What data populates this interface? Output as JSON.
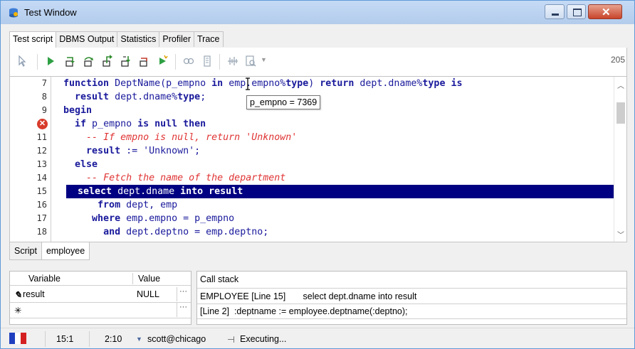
{
  "window": {
    "title": "Test Window"
  },
  "tabs": [
    "Test script",
    "DBMS Output",
    "Statistics",
    "Profiler",
    "Trace"
  ],
  "toolbar": {
    "right_value": "205"
  },
  "editor": {
    "line_numbers": [
      "7",
      "8",
      "9",
      "",
      "11",
      "12",
      "13",
      "14",
      "15",
      "16",
      "17",
      "18"
    ],
    "error_line_icon": "error-x-icon",
    "lines": [
      {
        "indent": "  ",
        "parts": [
          {
            "t": "function",
            "k": 1
          },
          {
            "t": " DeptName(p_empno "
          },
          {
            "t": "in",
            "k": 1
          },
          {
            "t": " emp.empno%"
          },
          {
            "t": "type",
            "k": 1
          },
          {
            "t": ") "
          },
          {
            "t": "return",
            "k": 1
          },
          {
            "t": " dept.dname%"
          },
          {
            "t": "type",
            "k": 1
          },
          {
            "t": " "
          },
          {
            "t": "is",
            "k": 1
          }
        ]
      },
      {
        "indent": "    ",
        "parts": [
          {
            "t": "result",
            "k": 1
          },
          {
            "t": " dept.dname%"
          },
          {
            "t": "type",
            "k": 1
          },
          {
            "t": ";"
          }
        ]
      },
      {
        "indent": "  ",
        "parts": [
          {
            "t": "begin",
            "k": 1
          }
        ]
      },
      {
        "indent": "    ",
        "parts": [
          {
            "t": "if",
            "k": 1
          },
          {
            "t": " p_empno "
          },
          {
            "t": "is null then",
            "k": 1
          }
        ]
      },
      {
        "indent": "      ",
        "parts": [
          {
            "t": "-- If empno is null, return 'Unknown'",
            "c": 1
          }
        ]
      },
      {
        "indent": "      ",
        "parts": [
          {
            "t": "result",
            "k": 1
          },
          {
            "t": " := 'Unknown';"
          }
        ]
      },
      {
        "indent": "    ",
        "parts": [
          {
            "t": "else",
            "k": 1
          }
        ]
      },
      {
        "indent": "      ",
        "parts": [
          {
            "t": "-- Fetch the name of the department",
            "c": 1
          }
        ]
      },
      {
        "indent": "    ",
        "parts": [
          {
            "t": "select",
            "k": 1
          },
          {
            "t": " dept.dname "
          },
          {
            "t": "into result",
            "k": 1
          }
        ]
      },
      {
        "indent": "        ",
        "parts": [
          {
            "t": "from",
            "k": 1
          },
          {
            "t": " dept, emp"
          }
        ]
      },
      {
        "indent": "       ",
        "parts": [
          {
            "t": "where",
            "k": 1
          },
          {
            "t": " emp.empno = p_empno"
          }
        ]
      },
      {
        "indent": "         ",
        "parts": [
          {
            "t": "and",
            "k": 1
          },
          {
            "t": " dept.deptno = emp.deptno;"
          }
        ]
      }
    ],
    "highlighted_line_index": 8,
    "tooltip": "p_empno = 7369"
  },
  "bottom_tabs": [
    "Script",
    "employee"
  ],
  "variables": {
    "headers": [
      "Variable",
      "Value"
    ],
    "rows": [
      {
        "name": "result",
        "value": "NULL",
        "marker": "pencil-icon"
      },
      {
        "name": "",
        "value": "",
        "marker": "asterisk-icon"
      }
    ]
  },
  "callstack": {
    "header": "Call stack",
    "rows": [
      "EMPLOYEE [Line 15]       select dept.dname into result",
      "[Line 2]  :deptname := employee.deptname(:deptno);"
    ]
  },
  "status": {
    "position": "15:1",
    "time": "2:10",
    "connection": "scott@chicago",
    "state": "Executing..."
  },
  "colors": {
    "highlight": "#000082",
    "keyword": "#1a1a9c",
    "comment": "#e03434",
    "titlebar": "#c5daf5"
  }
}
